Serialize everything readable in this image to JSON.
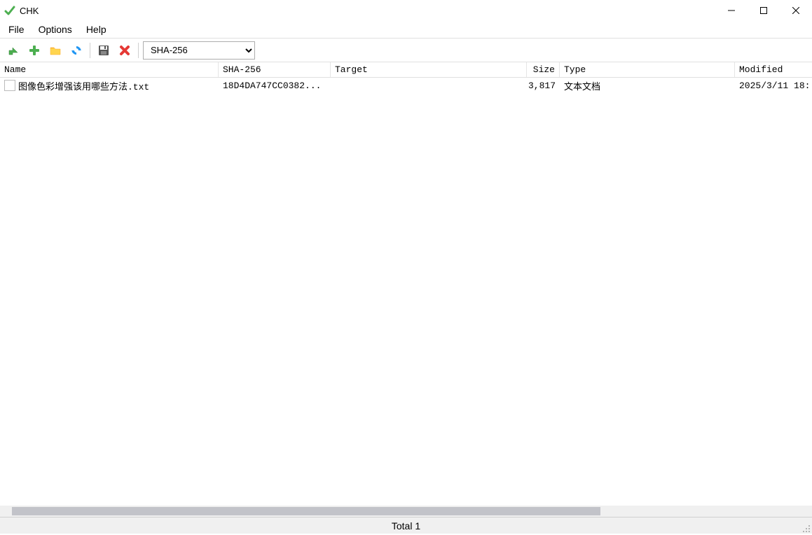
{
  "window": {
    "title": "CHK"
  },
  "menu": {
    "file": "File",
    "options": "Options",
    "help": "Help"
  },
  "toolbar": {
    "hash_selected": "SHA-256"
  },
  "columns": {
    "name": "Name",
    "hash": "SHA-256",
    "target": "Target",
    "size": "Size",
    "type": "Type",
    "modified": "Modified"
  },
  "files": [
    {
      "name": "图像色彩增强该用哪些方法.txt",
      "hash": "18D4DA747CC0382...",
      "target": "",
      "size": "3,817",
      "type": "文本文档",
      "modified": "2025/3/11 18:"
    }
  ],
  "status": {
    "total": "Total 1"
  }
}
